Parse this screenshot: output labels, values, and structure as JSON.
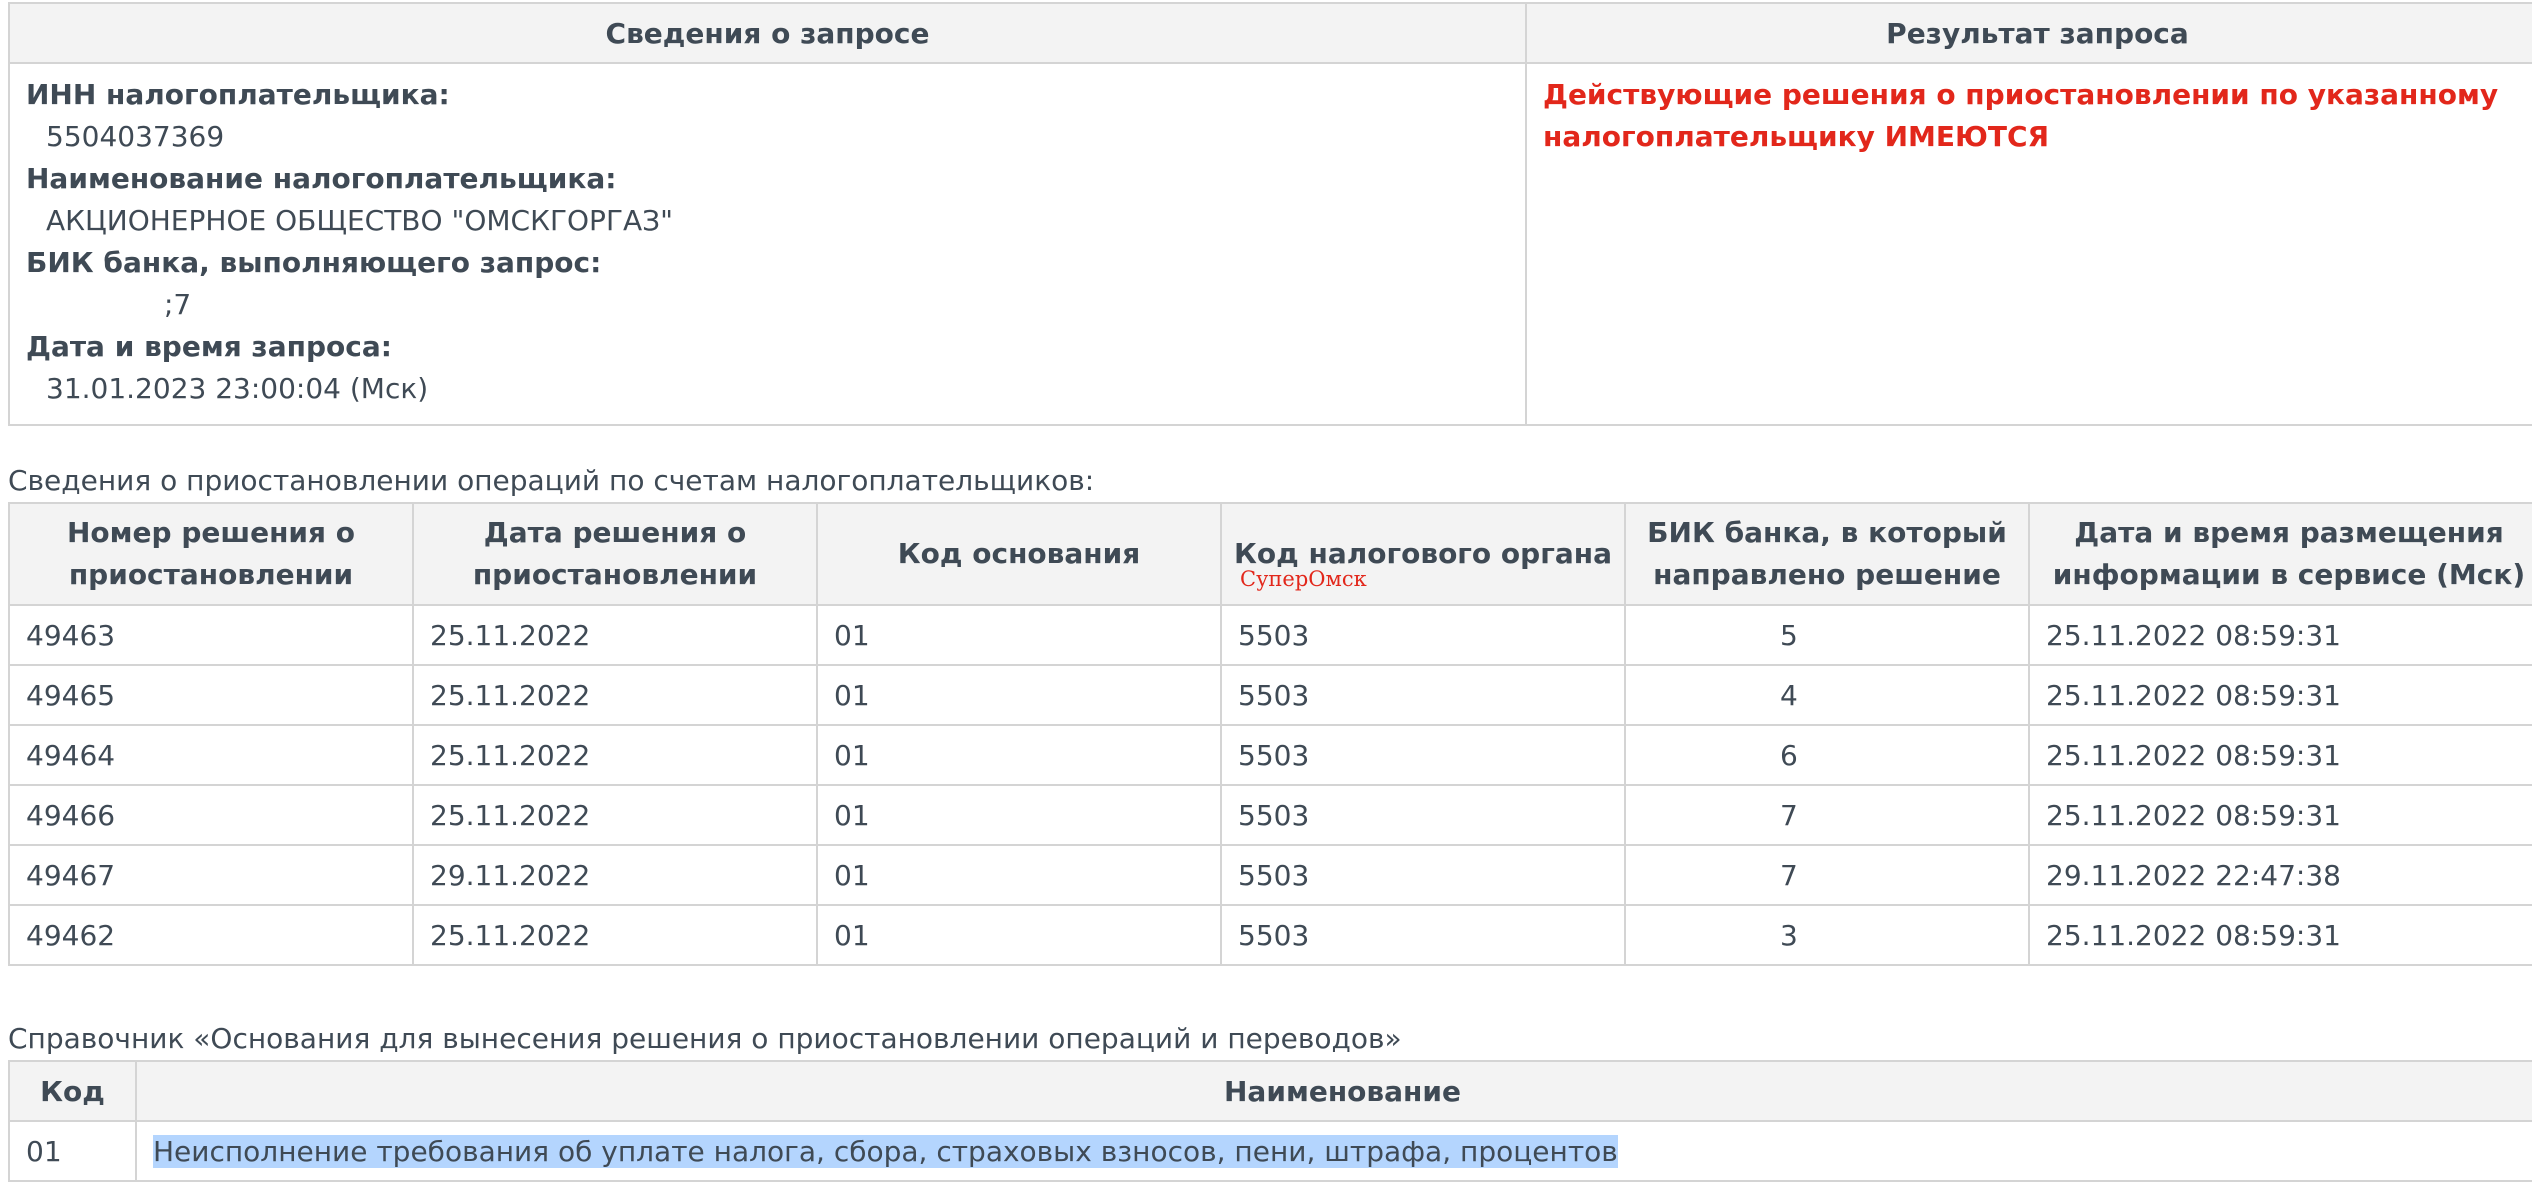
{
  "request_info": {
    "header_left": "Сведения о запросе",
    "header_right": "Результат запроса",
    "inn_label": "ИНН налогоплательщика:",
    "inn_value": "5504037369",
    "name_label": "Наименование налогоплательщика:",
    "name_value": "АКЦИОНЕРНОЕ ОБЩЕСТВО \"ОМСКГОРГАЗ\"",
    "bik_label": "БИК банка, выполняющего запрос:",
    "bik_value": ";7",
    "datetime_label": "Дата и время запроса:",
    "datetime_value": "31.01.2023 23:00:04 (Мск)",
    "result_text": "Действующие решения о приостановлении по указанному налогоплательщику ИМЕЮТСЯ",
    "result_color": "#e2271b"
  },
  "suspensions": {
    "caption": "Сведения о приостановлении операций по счетам налогоплательщиков:",
    "stamp": "СуперОмск",
    "columns": [
      "Номер решения о приостановлении",
      "Дата решения о приостановлении",
      "Код основания",
      "Код налогового органа",
      "БИК банка, в который направлено решение",
      "Дата и время размещения информации в сервисе (Мск)"
    ],
    "rows": [
      {
        "number": "49463",
        "date": "25.11.2022",
        "code": "01",
        "tax_code": "5503",
        "bik": "5",
        "placed": "25.11.2022 08:59:31"
      },
      {
        "number": "49465",
        "date": "25.11.2022",
        "code": "01",
        "tax_code": "5503",
        "bik": "4",
        "placed": "25.11.2022 08:59:31"
      },
      {
        "number": "49464",
        "date": "25.11.2022",
        "code": "01",
        "tax_code": "5503",
        "bik": "6",
        "placed": "25.11.2022 08:59:31"
      },
      {
        "number": "49466",
        "date": "25.11.2022",
        "code": "01",
        "tax_code": "5503",
        "bik": "7",
        "placed": "25.11.2022 08:59:31"
      },
      {
        "number": "49467",
        "date": "29.11.2022",
        "code": "01",
        "tax_code": "5503",
        "bik": "7",
        "placed": "29.11.2022 22:47:38"
      },
      {
        "number": "49462",
        "date": "25.11.2022",
        "code": "01",
        "tax_code": "5503",
        "bik": "3",
        "placed": "25.11.2022 08:59:31"
      }
    ]
  },
  "reference": {
    "caption": "Справочник «Основания для вынесения решения о приостановлении операций и переводов»",
    "columns": [
      "Код",
      "Наименование"
    ],
    "rows": [
      {
        "code": "01",
        "name": "Неисполнение требования об уплате налога, сбора, страховых взносов, пени, штрафа, процентов"
      }
    ],
    "highlight_color": "#b4d5fe"
  }
}
